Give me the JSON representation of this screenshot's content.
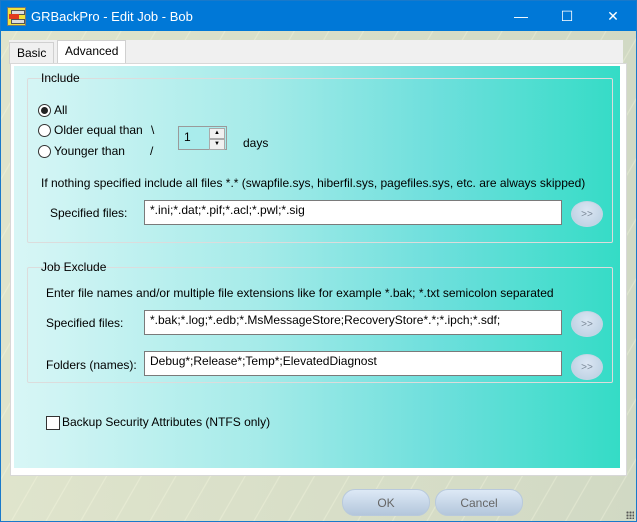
{
  "window": {
    "title": "GRBackPro - Edit Job - Bob",
    "controls": {
      "minimize": "—",
      "maximize": "☐",
      "close": "✕"
    }
  },
  "tabs": [
    {
      "label": "Basic",
      "active": false
    },
    {
      "label": "Advanced",
      "active": true
    }
  ],
  "include": {
    "group_label": "Include",
    "radio_options": [
      {
        "label": "All",
        "checked": true
      },
      {
        "label": "Older equal than",
        "checked": false
      },
      {
        "label": "Younger than",
        "checked": false
      }
    ],
    "bracket_top": "\\",
    "bracket_bottom": "/",
    "days_value": "1",
    "days_label": "days",
    "info_text": "If nothing specified include all files *.* (swapfile.sys, hiberfil.sys, pagefiles.sys, etc. are always skipped)",
    "specified_files_label": "Specified files:",
    "specified_files_value": "*.ini;*.dat;*.pif;*.acl;*.pwl;*.sig",
    "browse_label": ">>"
  },
  "exclude": {
    "group_label": "Job Exclude",
    "info_text": "Enter file names and/or multiple file extensions like for example *.bak; *.txt semicolon separated",
    "specified_files_label": "Specified files:",
    "specified_files_value": "*.bak;*.log;*.edb;*.MsMessageStore;RecoveryStore*.*;*.ipch;*.sdf;",
    "folders_label": "Folders (names):",
    "folders_value": "Debug*;Release*;Temp*;ElevatedDiagnost",
    "browse_label": ">>"
  },
  "backup_security": {
    "label": "Backup Security Attributes (NTFS only)",
    "checked": false
  },
  "buttons": {
    "ok": "OK",
    "cancel": "Cancel"
  },
  "icons": {
    "spin_up": "▲",
    "spin_down": "▼"
  }
}
